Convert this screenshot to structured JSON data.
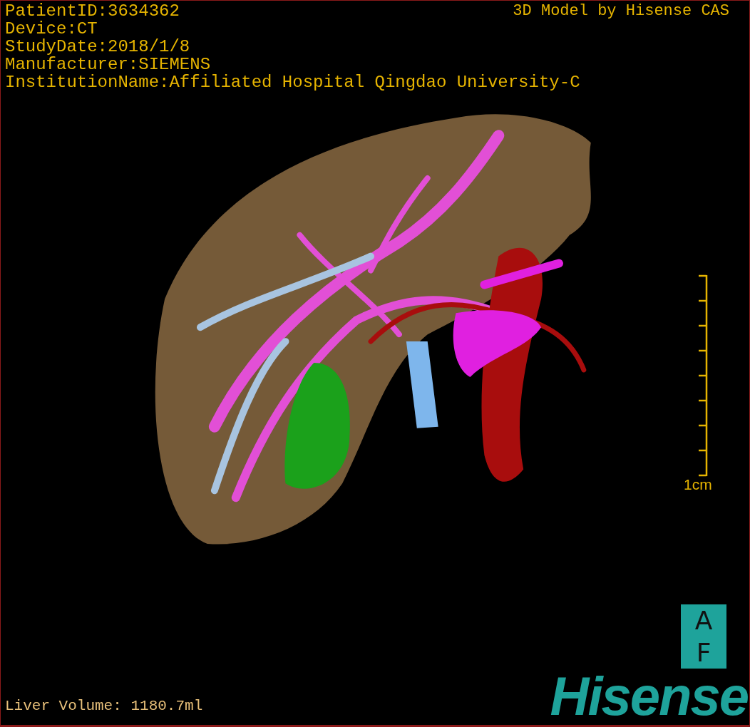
{
  "patient_info": [
    "PatientID:3634362",
    "Device:CT",
    "StudyDate:2018/1/8",
    "Manufacturer:SIEMENS",
    "InstitutionName:Affiliated Hospital Qingdao University-C"
  ],
  "model_credit": "3D Model by Hisense CAS",
  "scale_bar": {
    "label": "1cm"
  },
  "orientation_marker": {
    "letters": [
      "A",
      "F"
    ]
  },
  "logo": "Hisense",
  "liver_volume": "Liver Volume: 1180.7ml"
}
